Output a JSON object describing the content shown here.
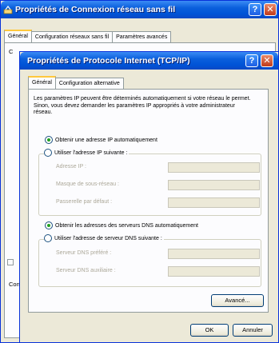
{
  "outer": {
    "title": "Propriétés de Connexion réseau sans fil",
    "help_glyph": "?",
    "close_glyph": "✕",
    "tabs": [
      "Général",
      "Configuration réseaux sans fil",
      "Paramètres avancés"
    ],
    "partial_left_texts": [
      "C",
      "Con"
    ]
  },
  "inner": {
    "title": "Propriétés de Protocole Internet (TCP/IP)",
    "help_glyph": "?",
    "close_glyph": "✕",
    "tabs": [
      "Général",
      "Configuration alternative"
    ],
    "description": "Les paramètres IP peuvent être déterminés automatiquement si votre réseau le permet. Sinon, vous devez demander les paramètres IP appropriés à votre administrateur réseau.",
    "ip_auto_label": "Obtenir une adresse IP automatiquement",
    "ip_manual_label": "Utiliser l'adresse IP suivante :",
    "ip_fields": [
      "Adresse IP :",
      "Masque de sous-réseau :",
      "Passerelle par défaut :"
    ],
    "dns_auto_label": "Obtenir les adresses des serveurs DNS automatiquement",
    "dns_manual_label": "Utiliser l'adresse de serveur DNS suivante :",
    "dns_fields": [
      "Serveur DNS préféré :",
      "Serveur DNS auxiliaire :"
    ],
    "advanced_button": "Avancé...",
    "ok_button": "OK",
    "cancel_button": "Annuler"
  },
  "selection": {
    "ip_mode": "automatic",
    "dns_mode": "automatic"
  },
  "colors": {
    "title_blue": "#0053d6",
    "dialog_bg": "#ece9d8",
    "close_red": "#c13a1a",
    "active_tab_accent": "#ffc83c"
  }
}
